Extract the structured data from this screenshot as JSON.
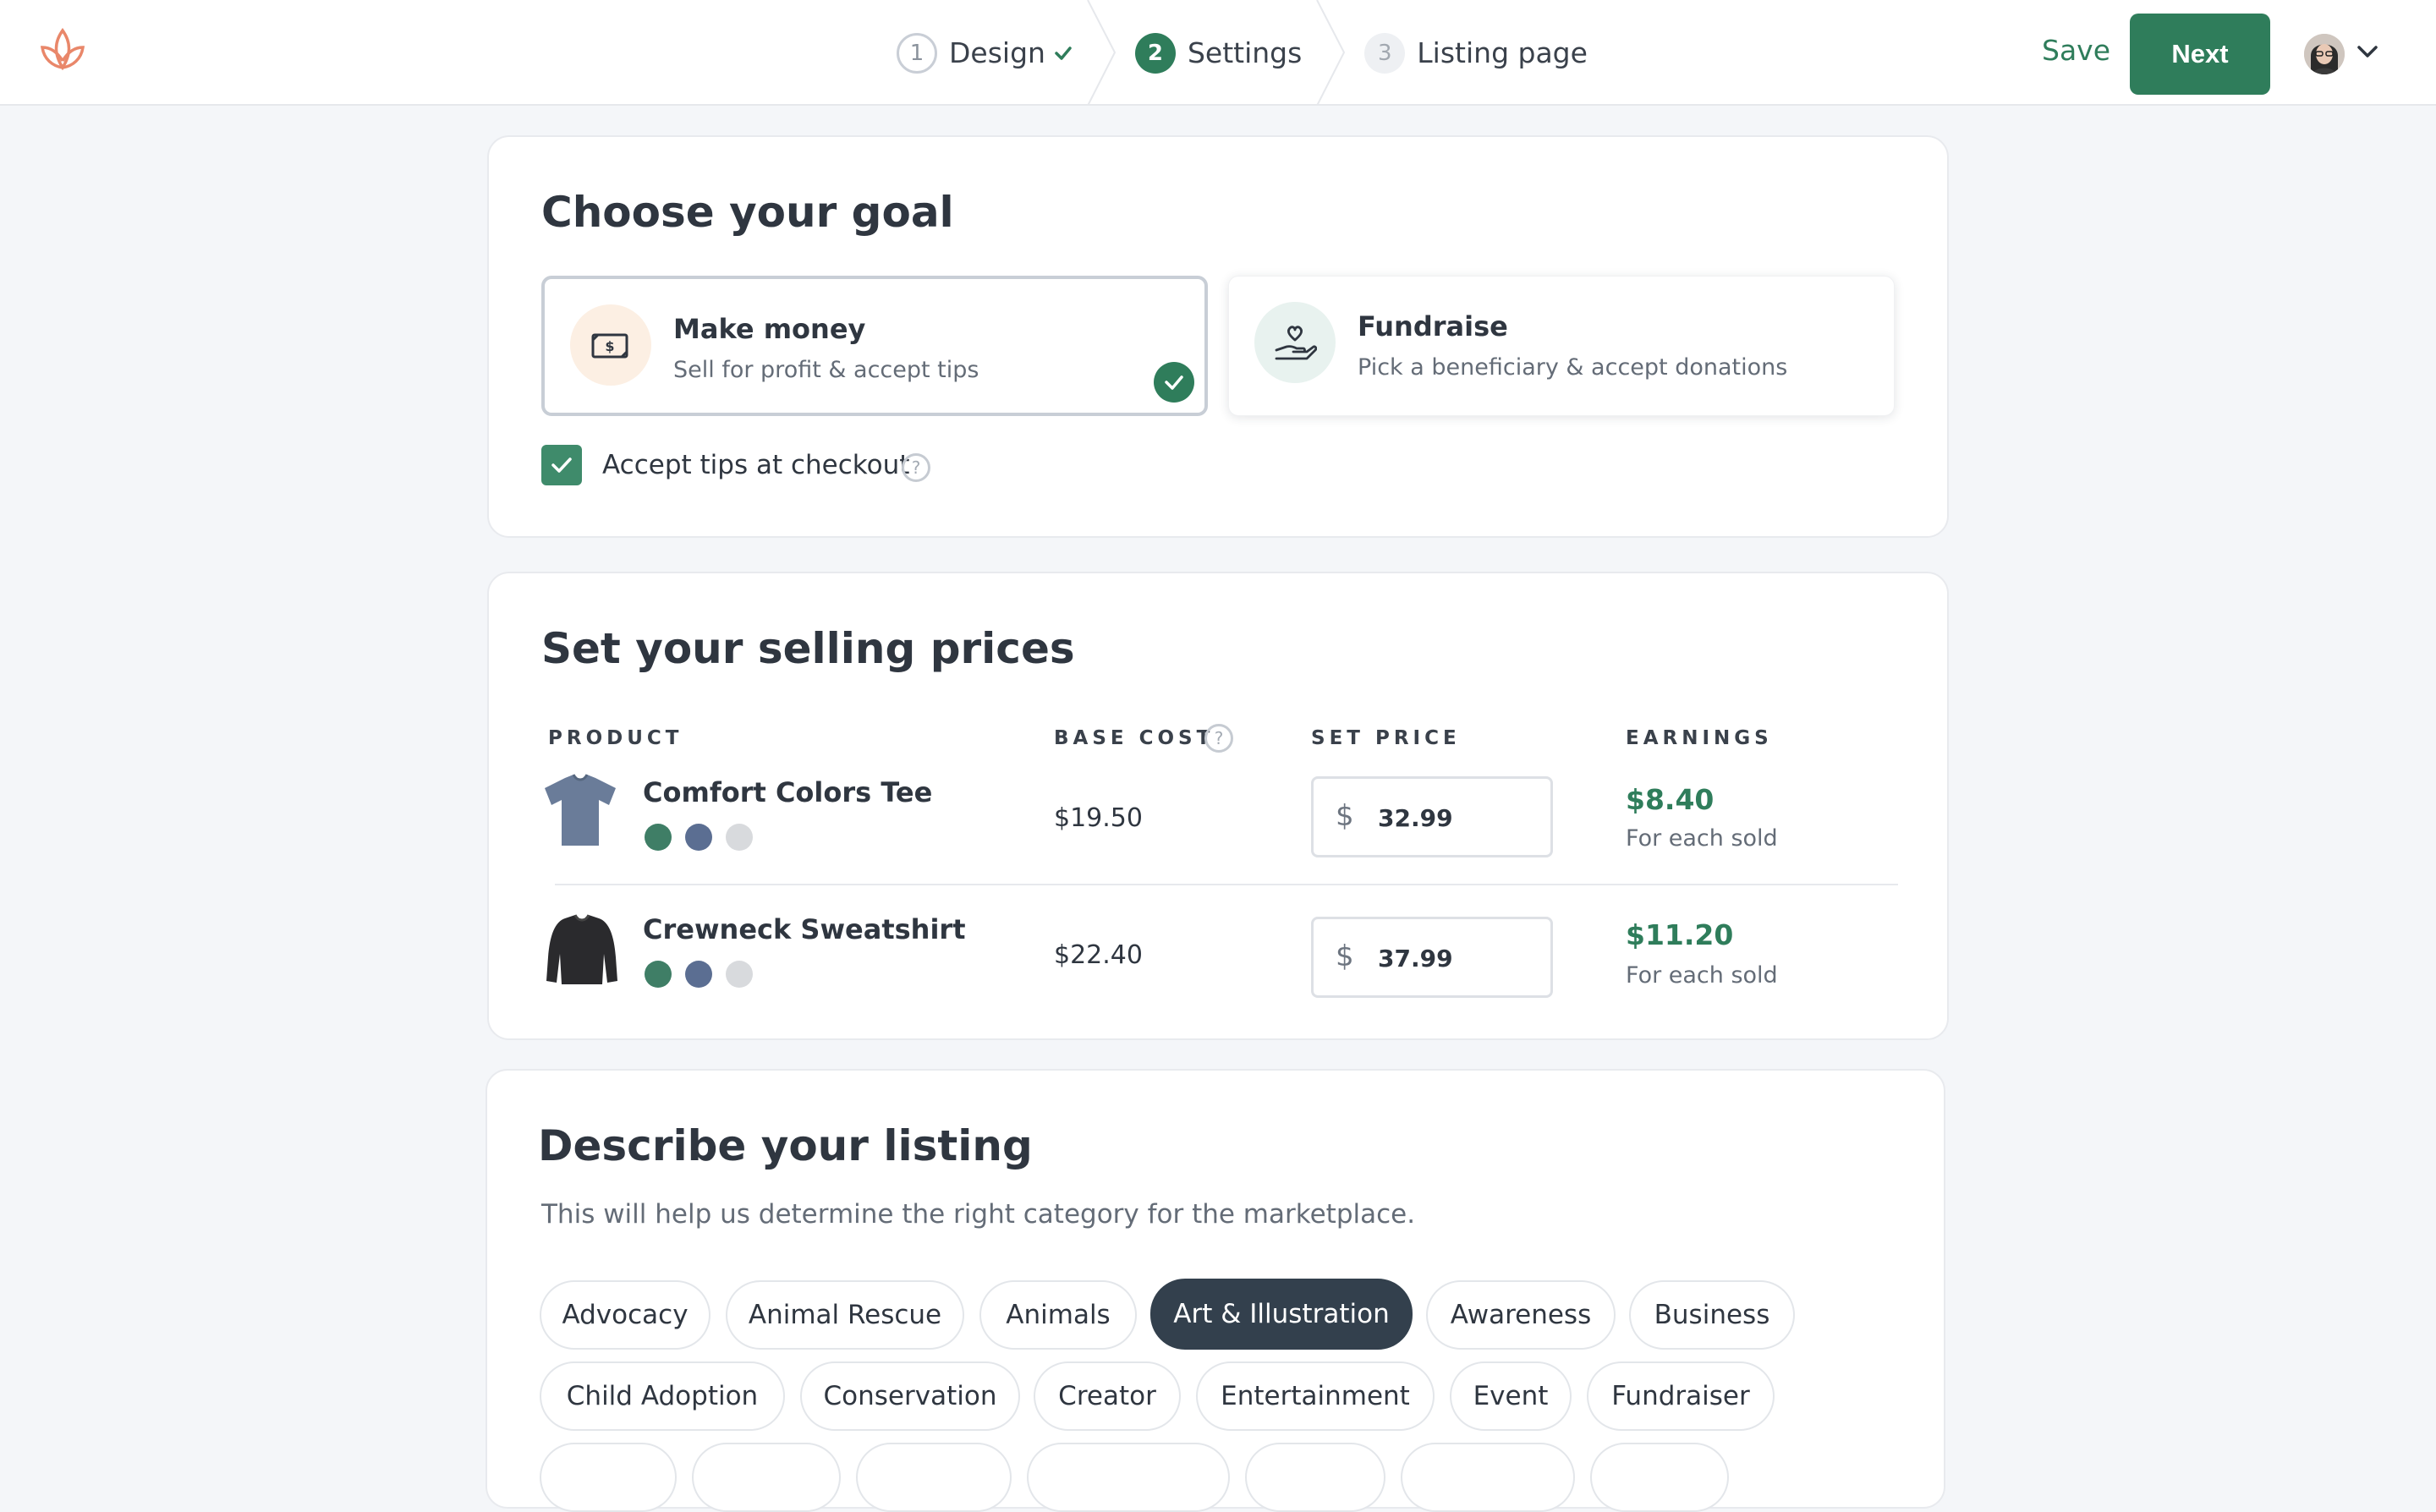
{
  "header": {
    "steps": [
      {
        "num": "1",
        "label": "Design",
        "state": "done"
      },
      {
        "num": "2",
        "label": "Settings",
        "state": "active"
      },
      {
        "num": "3",
        "label": "Listing page",
        "state": "upcoming"
      }
    ],
    "save_label": "Save",
    "next_label": "Next"
  },
  "goal": {
    "title": "Choose your goal",
    "options": [
      {
        "title": "Make money",
        "subtitle": "Sell for profit & accept tips",
        "selected": true,
        "icon": "money-icon"
      },
      {
        "title": "Fundraise",
        "subtitle": "Pick a beneficiary & accept donations",
        "selected": false,
        "icon": "hand-heart-icon"
      }
    ],
    "tips_label": "Accept tips at checkout",
    "tips_checked": true
  },
  "prices": {
    "title": "Set your selling prices",
    "headers": {
      "product": "PRODUCT",
      "base_cost": "BASE COST",
      "set_price": "SET PRICE",
      "earnings": "EARNINGS"
    },
    "rows": [
      {
        "name": "Comfort Colors Tee",
        "base_cost": "$19.50",
        "currency": "$",
        "price": "32.99",
        "earnings": "$8.40",
        "earnings_note": "For each sold",
        "swatches": [
          "#3f7e66",
          "#5b6e92",
          "#d8dadd"
        ]
      },
      {
        "name": "Crewneck Sweatshirt",
        "base_cost": "$22.40",
        "currency": "$",
        "price": "37.99",
        "earnings": "$11.20",
        "earnings_note": "For each sold",
        "swatches": [
          "#3f7e66",
          "#5b6e92",
          "#d8dadd"
        ]
      }
    ]
  },
  "listing": {
    "title": "Describe your listing",
    "subtitle": "This will help us determine the right category for the marketplace.",
    "categories_row1": [
      "Advocacy",
      "Animal Rescue",
      "Animals",
      "Art & Illustration",
      "Awareness",
      "Business"
    ],
    "categories_row2": [
      "Child Adoption",
      "Conservation",
      "Creator",
      "Entertainment",
      "Event",
      "Fundraiser"
    ],
    "selected": "Art & Illustration"
  },
  "colors": {
    "accent": "#2f7d5b",
    "chip_active": "#33404d"
  }
}
